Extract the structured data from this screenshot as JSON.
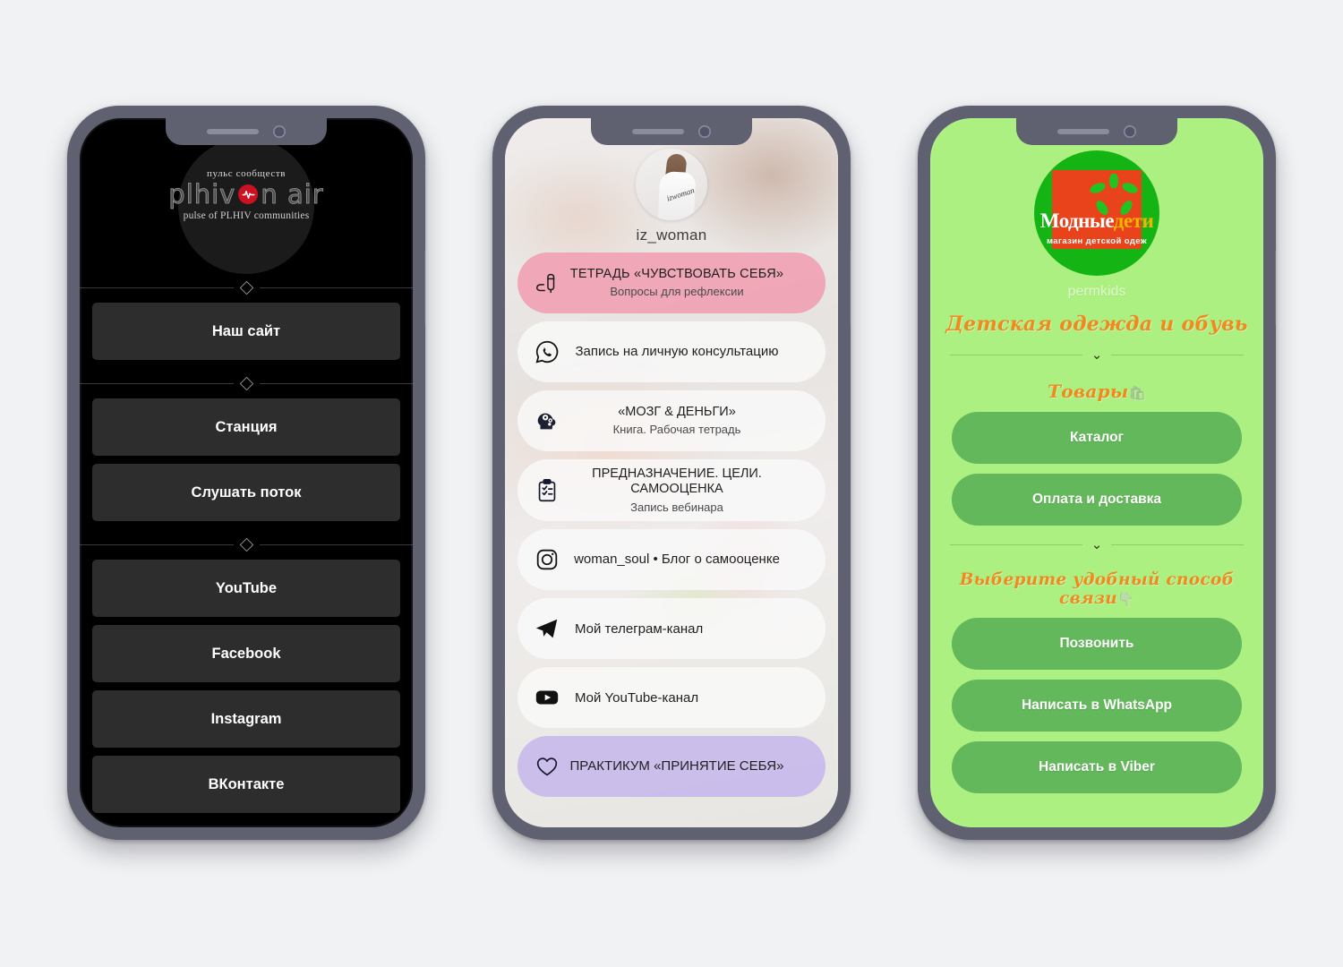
{
  "page": {
    "background_color": "#f1f2f4",
    "frame_color": "#5f6070"
  },
  "phone1": {
    "screen_background": "#000000",
    "logo": {
      "tagline_ru": "пульс сообществ",
      "wordmark_left": "plhiv",
      "wordmark_right": "n air",
      "beat_icon": "heartbeat-icon",
      "tagline_en": "pulse of PLHIV communities"
    },
    "buttons": [
      {
        "label": "Наш сайт"
      },
      {
        "label": "Станция"
      },
      {
        "label": "Слушать поток"
      },
      {
        "label": "YouTube"
      },
      {
        "label": "Facebook"
      },
      {
        "label": "Instagram"
      },
      {
        "label": "ВКонтакте"
      }
    ],
    "button_color": "#2d2d2d",
    "divider_icon": "diamond-divider-icon"
  },
  "phone2": {
    "handle": "iz_woman",
    "avatar_icon": "profile-avatar",
    "cards": [
      {
        "icon": "notebook-pen-icon",
        "title": "ТЕТРАДЬ «ЧУВСТВОВАТЬ СЕБЯ»",
        "subtitle": "Вопросы для рефлексии",
        "style": "pink",
        "color": "#f09eb2"
      },
      {
        "icon": "whatsapp-icon",
        "title": "Запись на личную консультацию",
        "subtitle": "",
        "style": "light"
      },
      {
        "icon": "brain-gears-icon",
        "title": "«МОЗГ & ДЕНЬГИ»",
        "subtitle": "Книга. Рабочая тетрадь",
        "style": "light"
      },
      {
        "icon": "clipboard-check-icon",
        "title": "ПРЕДНАЗНАЧЕНИЕ. ЦЕЛИ. САМООЦЕНКА",
        "subtitle": "Запись вебинара",
        "style": "light"
      },
      {
        "icon": "instagram-icon",
        "title": "woman_soul • Блог о самооценке",
        "subtitle": "",
        "style": "light"
      },
      {
        "icon": "telegram-icon",
        "title": "Мой телеграм-канал",
        "subtitle": "",
        "style": "light"
      },
      {
        "icon": "youtube-icon",
        "title": "Мой YouTube-канал",
        "subtitle": "",
        "style": "light"
      },
      {
        "icon": "heart-icon",
        "title": "ПРАКТИКУМ «ПРИНЯТИЕ СЕБЯ»",
        "subtitle": "",
        "style": "lilac",
        "color": "#c8baeb"
      }
    ]
  },
  "phone3": {
    "screen_background": "#abf081",
    "button_color": "#62b85a",
    "accent_color": "#f08a1e",
    "logo": {
      "name_part1": "Модные",
      "name_part2": "дети",
      "subtitle": "магазин детской одеж",
      "flower_icon": "flower-icon"
    },
    "handle": "permkids",
    "heading": "Детская одежда и обувь",
    "section_goods": "Товары",
    "section_goods_emoji": "🛍",
    "section_contact": "Выберите удобный способ связи",
    "section_contact_emoji": "👇",
    "chevron_icon": "chevron-down-icon",
    "buttons_goods": [
      {
        "label": "Каталог"
      },
      {
        "label": "Оплата и доставка"
      }
    ],
    "buttons_contact": [
      {
        "label": "Позвонить"
      },
      {
        "label": "Написать в WhatsApp"
      },
      {
        "label": "Написать в Viber"
      }
    ]
  }
}
